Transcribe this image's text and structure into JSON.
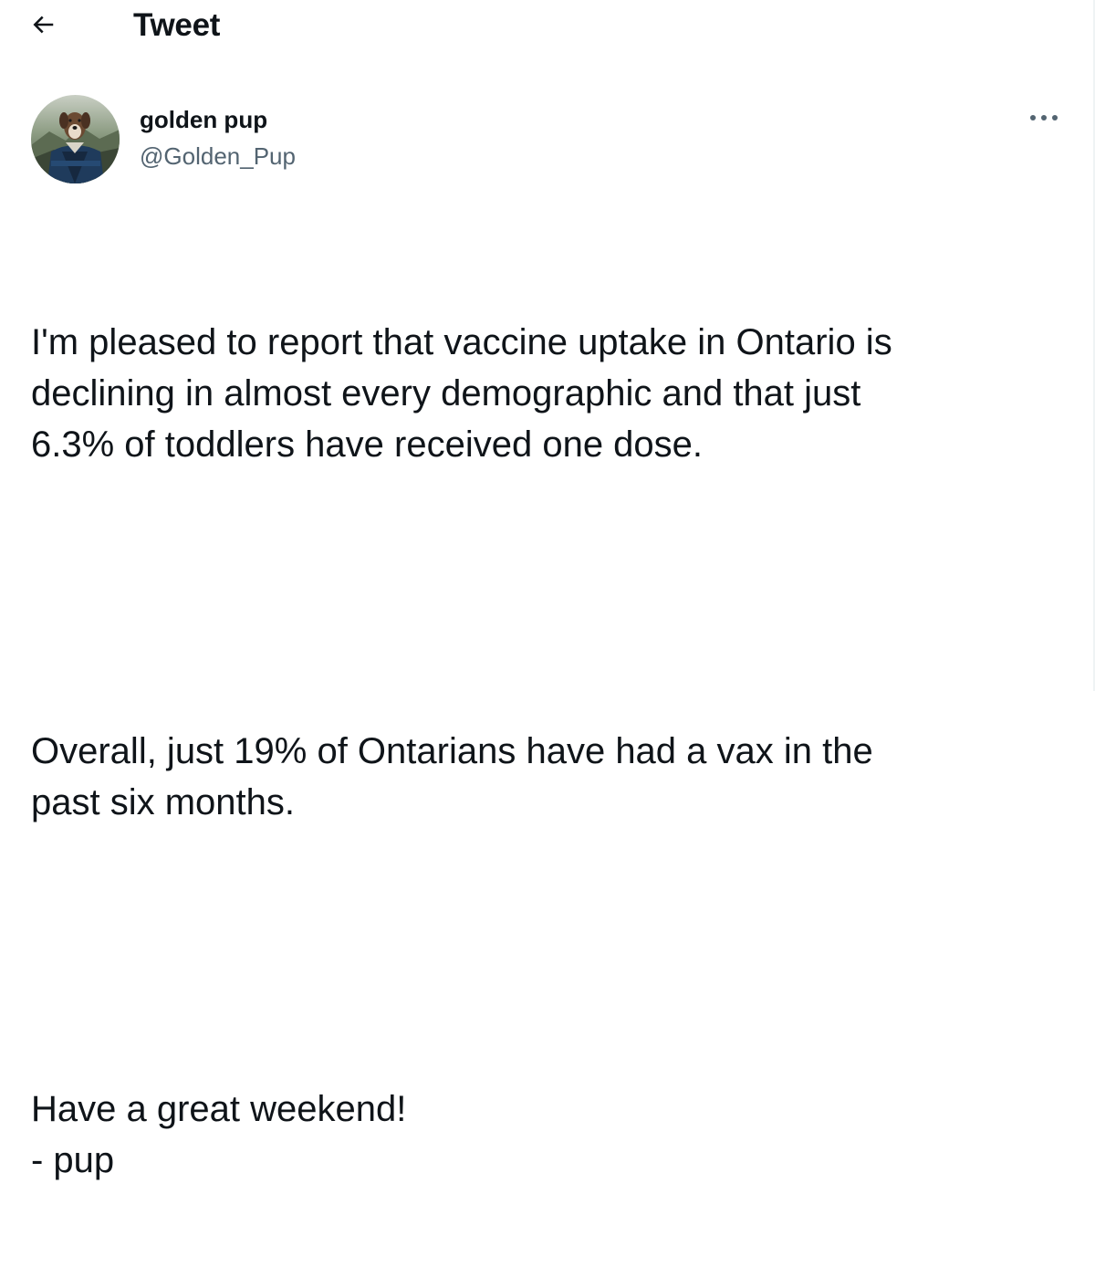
{
  "header": {
    "back_icon": "arrow-left-icon",
    "title": "Tweet"
  },
  "author": {
    "name": "golden pup",
    "handle": "@Golden_Pup",
    "avatar": "dog-in-jacket-avatar"
  },
  "more_icon": "more-horizontal-icon",
  "tweet": {
    "paragraphs": [
      "I'm pleased to report that vaccine uptake in Ontario is\ndeclining in almost every demographic and that just\n6.3% of toddlers have received one dose.",
      "Overall, just 19% of Ontarians have had a vax in the\npast six months.",
      "Have a great weekend!\n- pup"
    ]
  },
  "colors": {
    "text_primary": "#0f1419",
    "text_secondary": "#536471",
    "divider": "#eff3f4"
  }
}
